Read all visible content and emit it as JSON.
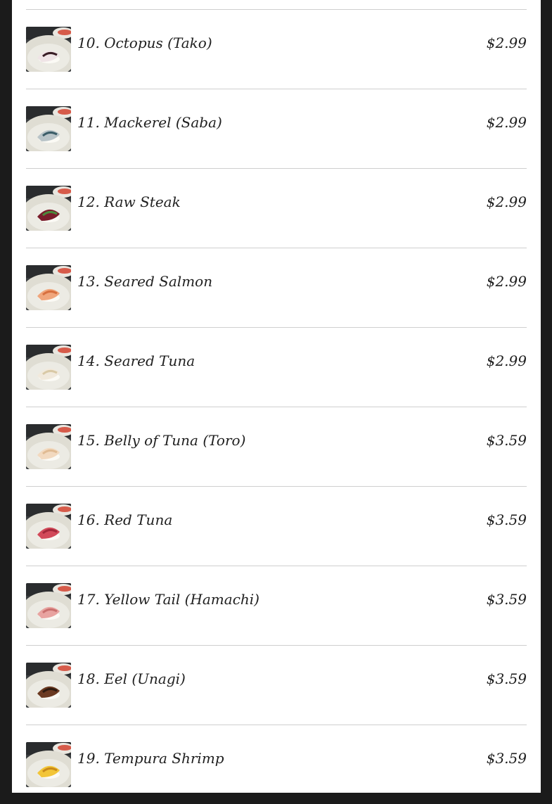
{
  "menu": {
    "items": [
      {
        "name": "10. Octopus (Tako)",
        "price": "$2.99",
        "image": "octopus-sushi-image",
        "topping": "#efe4e6",
        "accent": "#3a1e26"
      },
      {
        "name": "11. Mackerel (Saba)",
        "price": "$2.99",
        "image": "mackerel-sushi-image",
        "topping": "#b9c4c8",
        "accent": "#3b5d68"
      },
      {
        "name": "12. Raw Steak",
        "price": "$2.99",
        "image": "raw-steak-sushi-image",
        "topping": "#7a1d2c",
        "accent": "#4b8a3c"
      },
      {
        "name": "13. Seared Salmon",
        "price": "$2.99",
        "image": "seared-salmon-sushi-image",
        "topping": "#f0a67c",
        "accent": "#d7703f"
      },
      {
        "name": "14. Seared Tuna",
        "price": "$2.99",
        "image": "seared-tuna-sushi-image",
        "topping": "#f1e9dc",
        "accent": "#d9c9a6"
      },
      {
        "name": "15. Belly of Tuna (Toro)",
        "price": "$3.59",
        "image": "toro-sushi-image",
        "topping": "#f2d9bf",
        "accent": "#e0bb93"
      },
      {
        "name": "16. Red Tuna",
        "price": "$3.59",
        "image": "red-tuna-sushi-image",
        "topping": "#d24a5a",
        "accent": "#a2283a"
      },
      {
        "name": "17. Yellow Tail (Hamachi)",
        "price": "$3.59",
        "image": "yellowtail-sushi-image",
        "topping": "#e8a3a0",
        "accent": "#c9706e"
      },
      {
        "name": "18. Eel (Unagi)",
        "price": "$3.59",
        "image": "eel-sushi-image",
        "topping": "#6b3a22",
        "accent": "#2e1a10"
      },
      {
        "name": "19. Tempura Shrimp",
        "price": "$3.59",
        "image": "tempura-shrimp-sushi-image",
        "topping": "#f2c538",
        "accent": "#c98a1a"
      }
    ]
  }
}
